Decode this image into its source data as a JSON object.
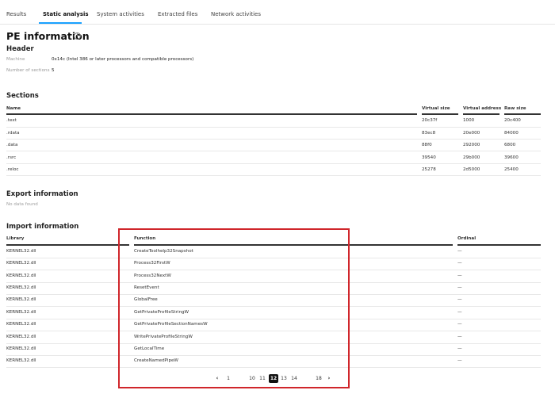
{
  "tabs": [
    {
      "label": "Results"
    },
    {
      "label": "Static analysis"
    },
    {
      "label": "System activities"
    },
    {
      "label": "Extracted files"
    },
    {
      "label": "Network activities"
    }
  ],
  "page_title": "PE information",
  "header": {
    "title": "Header",
    "machine_label": "Machine",
    "machine_value": "0x14c (Intel 386 or later processors and compatible processors)",
    "sections_label": "Number of sections",
    "sections_value": "5"
  },
  "sections": {
    "title": "Sections",
    "columns": [
      "Name",
      "Virtual size",
      "Virtual address",
      "Raw size"
    ],
    "rows": [
      [
        ".text",
        "20c37f",
        "1000",
        "20c400"
      ],
      [
        ".rdata",
        "83ec8",
        "20e000",
        "84000"
      ],
      [
        ".data",
        "88f0",
        "292000",
        "6800"
      ],
      [
        ".rsrc",
        "39540",
        "29b000",
        "39600"
      ],
      [
        ".reloc",
        "25278",
        "2d5000",
        "25400"
      ]
    ]
  },
  "export": {
    "title": "Export information",
    "empty": "No data found"
  },
  "import": {
    "title": "Import information",
    "columns": [
      "Library",
      "Function",
      "Ordinal"
    ],
    "rows": [
      [
        "KERNEL32.dll",
        "CreateToolhelp32Snapshot",
        "—"
      ],
      [
        "KERNEL32.dll",
        "Process32FirstW",
        "—"
      ],
      [
        "KERNEL32.dll",
        "Process32NextW",
        "—"
      ],
      [
        "KERNEL32.dll",
        "ResetEvent",
        "—"
      ],
      [
        "KERNEL32.dll",
        "GlobalFree",
        "—"
      ],
      [
        "KERNEL32.dll",
        "GetPrivateProfileStringW",
        "—"
      ],
      [
        "KERNEL32.dll",
        "GetPrivateProfileSectionNamesW",
        "—"
      ],
      [
        "KERNEL32.dll",
        "WritePrivateProfileStringW",
        "—"
      ],
      [
        "KERNEL32.dll",
        "GetLocalTime",
        "—"
      ],
      [
        "KERNEL32.dll",
        "CreateNamedPipeW",
        "—"
      ]
    ]
  },
  "pagination": {
    "prev_icon": "chevron-left-icon",
    "next_icon": "chevron-right-icon",
    "pages": [
      "1",
      "10",
      "11",
      "12",
      "13",
      "14",
      "18"
    ],
    "current": "12"
  }
}
